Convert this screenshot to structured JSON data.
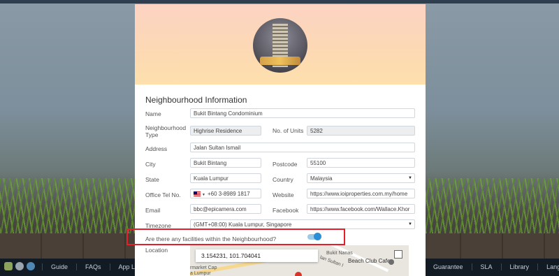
{
  "form": {
    "section_title": "Neighbourhood Information",
    "name_label": "Name",
    "name_value": "Bukit Bintang Condominium",
    "type_label_line1": "Neighbourhood",
    "type_label_line2": "Type",
    "type_value": "Highrise Residence",
    "units_label": "No. of Units",
    "units_value": "5282",
    "address_label": "Address",
    "address_value": "Jalan Sultan Ismail",
    "city_label": "City",
    "city_value": "Bukit Bintang",
    "postcode_label": "Postcode",
    "postcode_value": "55100",
    "state_label": "State",
    "state_value": "Kuala Lumpur",
    "country_label": "Country",
    "country_value": "Malaysia",
    "tel_label": "Office Tel No.",
    "tel_value": "+60 3-8989 1817",
    "website_label": "Website",
    "website_value": "https://www.ioiproperties.com.my/home",
    "email_label": "Email",
    "email_value": "bbc@epicamera.com",
    "facebook_label": "Facebook",
    "facebook_value": "https://www.facebook.com/Wallace.Khor",
    "timezone_label": "Timezone",
    "timezone_value": "(GMT+08:00) Kuala Lumpur, Singapore",
    "facilities_question": "Are there any facilities within the Neighbourhood?",
    "facilities_enabled": true,
    "location_label": "Location"
  },
  "map": {
    "coordinates": "3.154231, 101.704041",
    "place_label": "Beach Club Cafe",
    "street_1": "rmarket Cap",
    "street_2": "a Lumpur",
    "street_3": "lan Sultan I",
    "street_4": "Bukit Nanas"
  },
  "footer": {
    "links": [
      "Guide",
      "FAQs",
      "App Lock",
      "Guarantee",
      "SLA",
      "Library",
      "Language"
    ]
  },
  "colors": {
    "highlight": "#e3202a",
    "toggle_on": "#2b8fd8",
    "footer_bg": "#121b24"
  }
}
